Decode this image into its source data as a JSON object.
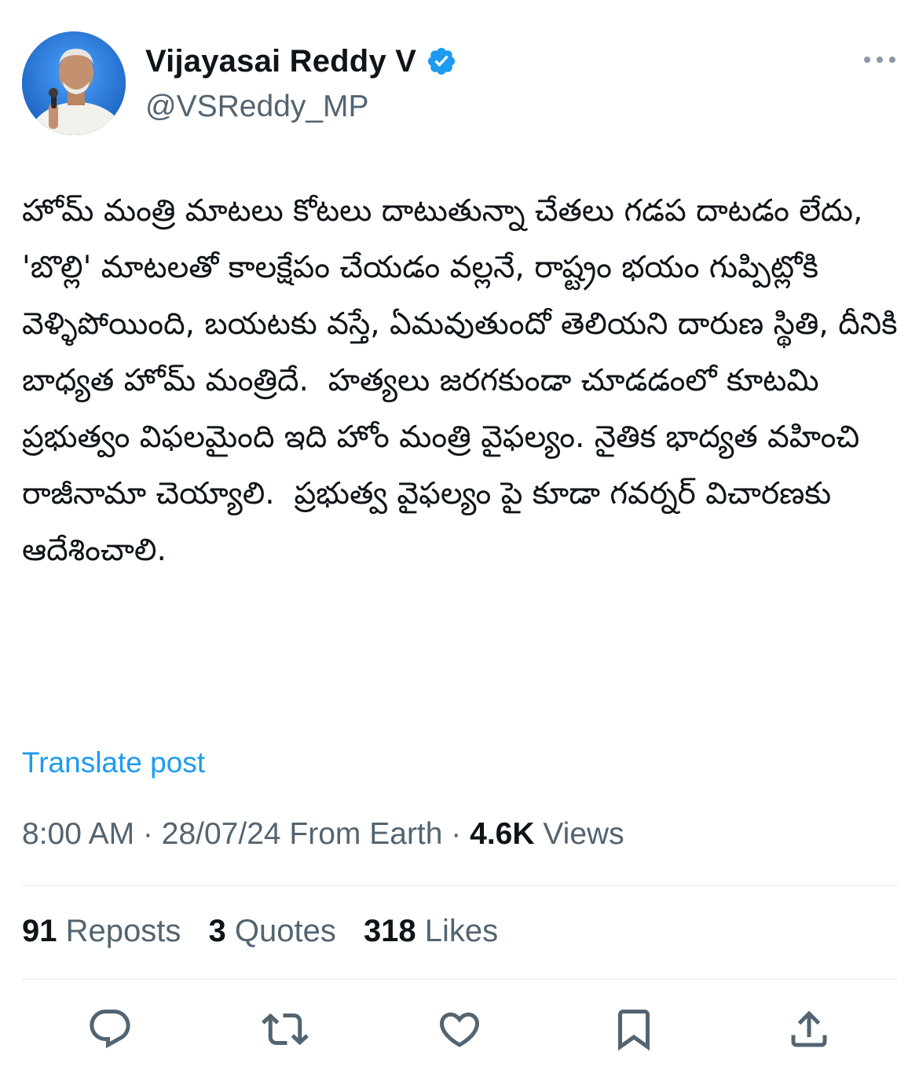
{
  "author": {
    "display_name": "Vijayasai Reddy V",
    "handle": "@VSReddy_MP"
  },
  "tweet": {
    "text": "హోమ్ మంత్రి మాటలు కోటలు దాటుతున్నా చేతలు గడప దాటడం లేదు, 'బొల్లి' మాటలతో కాలక్షేపం చేయడం వల్లనే, రాష్ట్రం భయం గుప్పిట్లోకి వెళ్ళిపోయింది, బయటకు వస్తే, ఏమవుతుందో తెలియని దారుణ స్థితి, దీనికి బాధ్యత హోమ్ మంత్రిదే.  హత్యలు జరగకుండా చూడడంలో కూటమి ప్రభుత్వం విఫలమైంది ఇది హోం మంత్రి వైఫల్యం. నైతిక భాద్యత వహించి రాజీనామా చెయ్యాలి.  ప్రభుత్వ వైఫల్యం పై కూడా గవర్నర్ విచారణకు ఆదేశించాలి.",
    "translate_label": "Translate post"
  },
  "meta": {
    "time": "8:00 AM",
    "separator": " · ",
    "date": "28/07/24",
    "source": " From Earth",
    "views_count": "4.6K",
    "views_label": " Views"
  },
  "stats": {
    "reposts_count": "91",
    "reposts_label": " Reposts",
    "quotes_count": "3",
    "quotes_label": " Quotes",
    "likes_count": "318",
    "likes_label": " Likes"
  },
  "icons": {
    "verified": "verified-badge-icon",
    "more": "more-icon",
    "reply": "reply-icon",
    "repost": "repost-icon",
    "like": "like-icon",
    "bookmark": "bookmark-icon",
    "share": "share-icon"
  },
  "colors": {
    "accent": "#1d9bf0",
    "text_primary": "#0f1419",
    "text_secondary": "#536471",
    "divider": "#eff3f4"
  }
}
